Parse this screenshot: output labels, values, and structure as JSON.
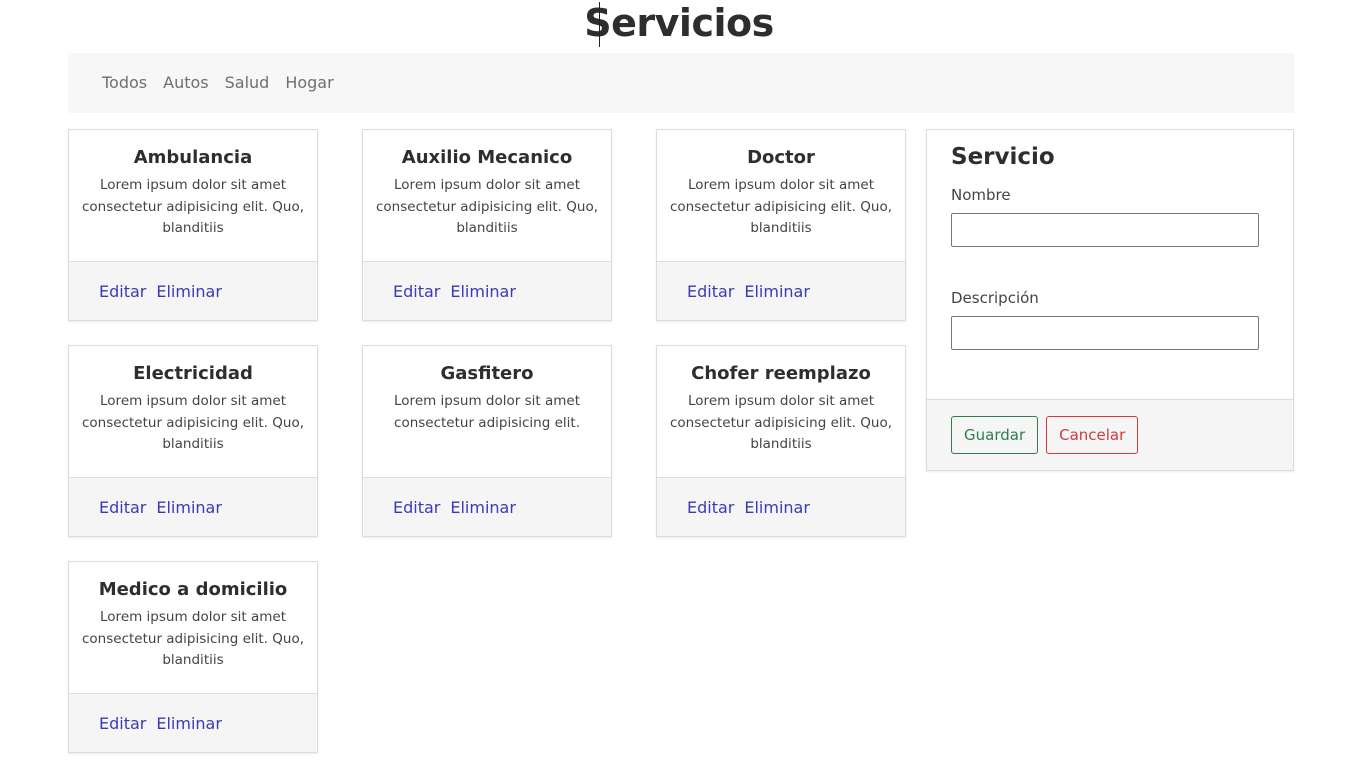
{
  "page": {
    "title": "Servicios"
  },
  "nav": {
    "items": [
      {
        "label": "Todos"
      },
      {
        "label": "Autos"
      },
      {
        "label": "Salud"
      },
      {
        "label": "Hogar"
      }
    ]
  },
  "services": [
    {
      "title": "Ambulancia",
      "text": "Lorem ipsum dolor sit amet consectetur adipisicing elit. Quo, blanditiis",
      "edit": "Editar",
      "delete": "Eliminar"
    },
    {
      "title": "Auxilio Mecanico",
      "text": "Lorem ipsum dolor sit amet consectetur adipisicing elit. Quo, blanditiis",
      "edit": "Editar",
      "delete": "Eliminar"
    },
    {
      "title": "Doctor",
      "text": "Lorem ipsum dolor sit amet consectetur adipisicing elit. Quo, blanditiis",
      "edit": "Editar",
      "delete": "Eliminar"
    },
    {
      "title": "Electricidad",
      "text": "Lorem ipsum dolor sit amet consectetur adipisicing elit. Quo, blanditiis",
      "edit": "Editar",
      "delete": "Eliminar"
    },
    {
      "title": "Gasfitero",
      "text": "Lorem ipsum dolor sit amet consectetur adipisicing elit.",
      "edit": "Editar",
      "delete": "Eliminar"
    },
    {
      "title": "Chofer reemplazo",
      "text": "Lorem ipsum dolor sit amet consectetur adipisicing elit. Quo, blanditiis",
      "edit": "Editar",
      "delete": "Eliminar"
    },
    {
      "title": "Medico a domicilio",
      "text": "Lorem ipsum dolor sit amet consectetur adipisicing elit. Quo, blanditiis",
      "edit": "Editar",
      "delete": "Eliminar"
    }
  ],
  "form": {
    "title": "Servicio",
    "name_label": "Nombre",
    "name_value": "",
    "description_label": "Descripción",
    "description_value": "",
    "save_label": "Guardar",
    "cancel_label": "Cancelar"
  },
  "colors": {
    "link": "#3a3ab8",
    "save": "#2e7d4f",
    "cancel": "#d03a3a",
    "nav_bg": "#f7f7f7",
    "footer_bg": "#f5f5f5"
  }
}
